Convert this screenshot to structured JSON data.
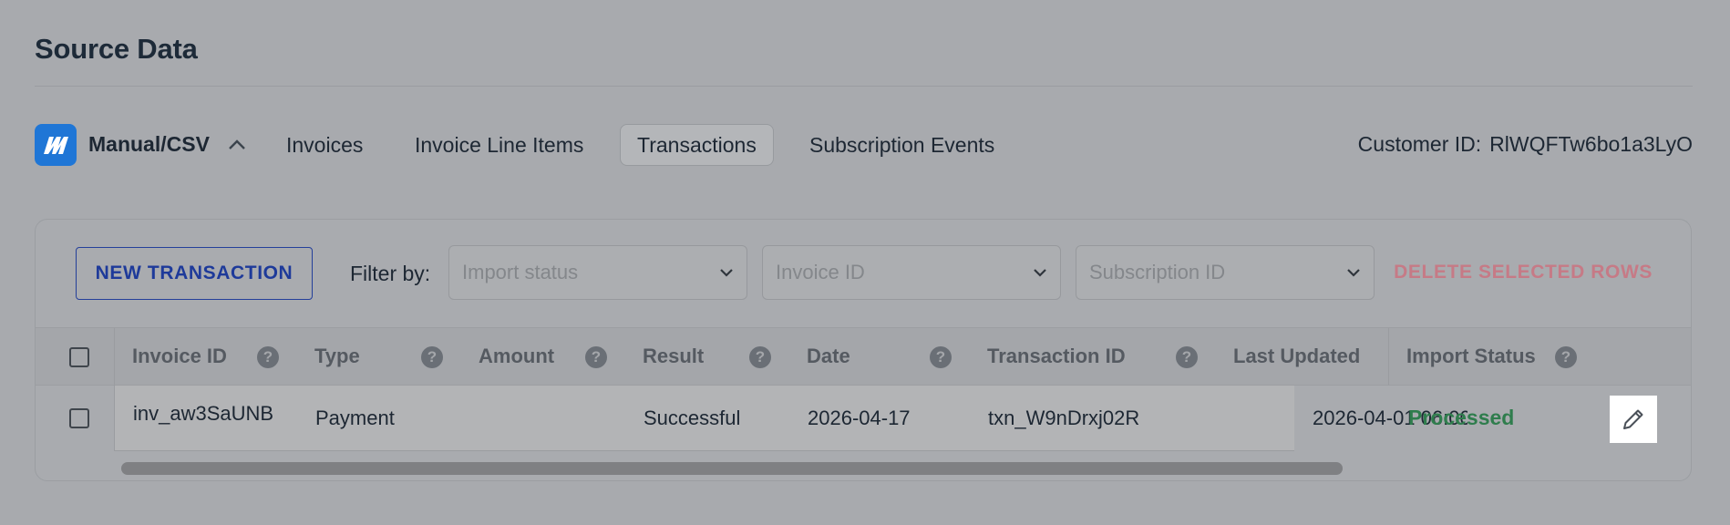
{
  "page": {
    "title": "Source Data"
  },
  "source": {
    "name": "Manual/CSV",
    "logo_icon": "manual-csv-logo-icon",
    "toggle_icon": "chevron-up-icon"
  },
  "tabs": [
    {
      "label": "Invoices",
      "active": false
    },
    {
      "label": "Invoice Line Items",
      "active": false
    },
    {
      "label": "Transactions",
      "active": true
    },
    {
      "label": "Subscription Events",
      "active": false
    }
  ],
  "customer": {
    "label": "Customer ID:",
    "value": "RlWQFTw6bo1a3LyO"
  },
  "toolbar": {
    "new_label": "NEW TRANSACTION",
    "filter_label": "Filter by:",
    "filters": [
      {
        "placeholder": "Import status"
      },
      {
        "placeholder": "Invoice ID"
      },
      {
        "placeholder": "Subscription ID"
      }
    ],
    "delete_label": "DELETE SELECTED ROWS"
  },
  "table": {
    "columns": [
      {
        "label": "Invoice ID",
        "help": "?"
      },
      {
        "label": "Type",
        "help": "?"
      },
      {
        "label": "Amount",
        "help": "?"
      },
      {
        "label": "Result",
        "help": "?"
      },
      {
        "label": "Date",
        "help": "?"
      },
      {
        "label": "Transaction ID",
        "help": "?"
      },
      {
        "label": "Last Updated"
      },
      {
        "label": "Import Status",
        "help": "?"
      }
    ],
    "rows": [
      {
        "invoice_id": "inv_aw3SaUNB",
        "type": "Payment",
        "amount": "",
        "result": "Successful",
        "date": "2026-04-17",
        "transaction_id": "txn_W9nDrxj02R",
        "last_updated": "2026-04-01 06:00",
        "import_status": "Processed"
      }
    ]
  },
  "colors": {
    "brand_blue": "#1f76d6",
    "primary_text": "#1e3a9a",
    "danger": "#c67a86",
    "success": "#2f7d4d"
  }
}
